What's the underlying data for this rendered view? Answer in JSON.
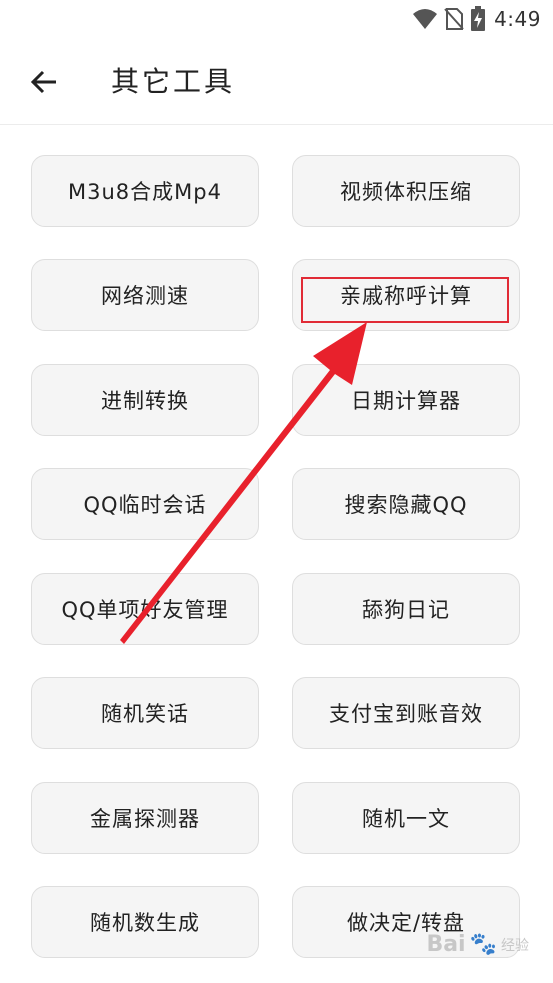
{
  "status_bar": {
    "time": "4:49",
    "icons": [
      "wifi-icon",
      "no-sim-icon",
      "battery-charging-icon"
    ]
  },
  "app_bar": {
    "title": "其它工具",
    "back_icon": "arrow-left-icon"
  },
  "tools": [
    {
      "label": "M3u8合成Mp4"
    },
    {
      "label": "视频体积压缩"
    },
    {
      "label": "网络测速"
    },
    {
      "label": "亲戚称呼计算"
    },
    {
      "label": "进制转换"
    },
    {
      "label": "日期计算器"
    },
    {
      "label": "QQ临时会话"
    },
    {
      "label": "搜索隐藏QQ"
    },
    {
      "label": "QQ单项好友管理"
    },
    {
      "label": "舔狗日记"
    },
    {
      "label": "随机笑话"
    },
    {
      "label": "支付宝到账音效"
    },
    {
      "label": "金属探测器"
    },
    {
      "label": "随机一文"
    },
    {
      "label": "随机数生成"
    },
    {
      "label": "做决定/转盘"
    }
  ],
  "annotation": {
    "highlighted_tool": "亲戚称呼计算",
    "color": "#e12b36"
  },
  "watermark": {
    "text": "Bai",
    "paw": "🐾",
    "suffix": "经验"
  }
}
